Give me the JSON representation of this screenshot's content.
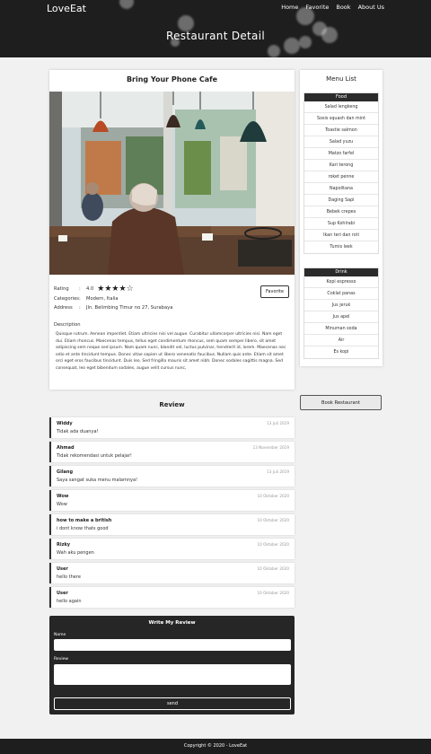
{
  "header": {
    "logo": "LoveEat",
    "nav": [
      "Home",
      "Favorite",
      "Book",
      "About Us"
    ],
    "title": "Restaurant Detail"
  },
  "detail": {
    "name": "Bring Your Phone Cafe",
    "rating_label": "Rating",
    "rating_value": "4.0",
    "rating_stars": 4,
    "categories_label": "Categories",
    "categories": "Modern, Italia",
    "address_label": "Address",
    "address": "Jln. Belimbing Timur no 27, Surabaya",
    "favorite_label": "Favorite",
    "description_label": "Description",
    "description": "Quisque rutrum. Aenean imperdiet. Etiam ultricies nisi vel augue. Curabitur ullamcorper ultricies nisi. Nam eget dui. Etiam rhoncus. Maecenas tempus, tellus eget condimentum rhoncus, sem quam semper libero, sit amet adipiscing sem neque sed ipsum. Nam quam nunc, blandit vel, luctus pulvinar, hendrerit id, lorem. Maecenas nec odio et ante tincidunt tempus. Donec vitae sapien ut libero venenatis faucibus. Nullam quis ante. Etiam sit amet orci eget eros faucibus tincidunt. Duis leo. Sed fringilla mauris sit amet nibh. Donec sodales sagittis magna. Sed consequat, leo eget bibendum sodales, augue velit cursus nunc,"
  },
  "menu": {
    "title": "Menu List",
    "food": {
      "heading": "Food",
      "items": [
        "Salad lengkeng",
        "Sosis squash dan mint",
        "Toastie salmon",
        "Salad yuzu",
        "Matzo farfel",
        "Kari terong",
        "roket penne",
        "Napolitana",
        "Daging Sapi",
        "Bebek crepes",
        "Sup Kohlrabi",
        "Ikan teri dan roti",
        "Tumis leek"
      ]
    },
    "drink": {
      "heading": "Drink",
      "items": [
        "Kopi espresso",
        "Coklat panas",
        "Jus jeruk",
        "Jus apel",
        "Minuman soda",
        "Air",
        "Es kopi"
      ]
    }
  },
  "book_label": "Book Restaurant",
  "review": {
    "heading": "Review",
    "items": [
      {
        "name": "Widdy",
        "date": "13 Juli 2019",
        "text": "Tidak ada duanya!"
      },
      {
        "name": "Ahmad",
        "date": "13 November 2019",
        "text": "Tidak rekomendasi untuk pelajar!"
      },
      {
        "name": "Gilang",
        "date": "13 Juli 2019",
        "text": "Saya sangat suka menu malamnya!"
      },
      {
        "name": "Wow",
        "date": "10 Oktober 2020",
        "text": "Wow"
      },
      {
        "name": "how to make a british",
        "date": "10 Oktober 2020",
        "text": "i dont know thats good"
      },
      {
        "name": "Rizky",
        "date": "10 Oktober 2020",
        "text": "Wah aku pengen"
      },
      {
        "name": "User",
        "date": "10 Oktober 2020",
        "text": "hello there"
      },
      {
        "name": "User",
        "date": "10 Oktober 2020",
        "text": "hello again"
      }
    ]
  },
  "write_review": {
    "title": "Write My Review",
    "name_label": "Name",
    "review_label": "Review",
    "send_label": "send"
  },
  "footer": "Copyright © 2020 - LoveEat"
}
